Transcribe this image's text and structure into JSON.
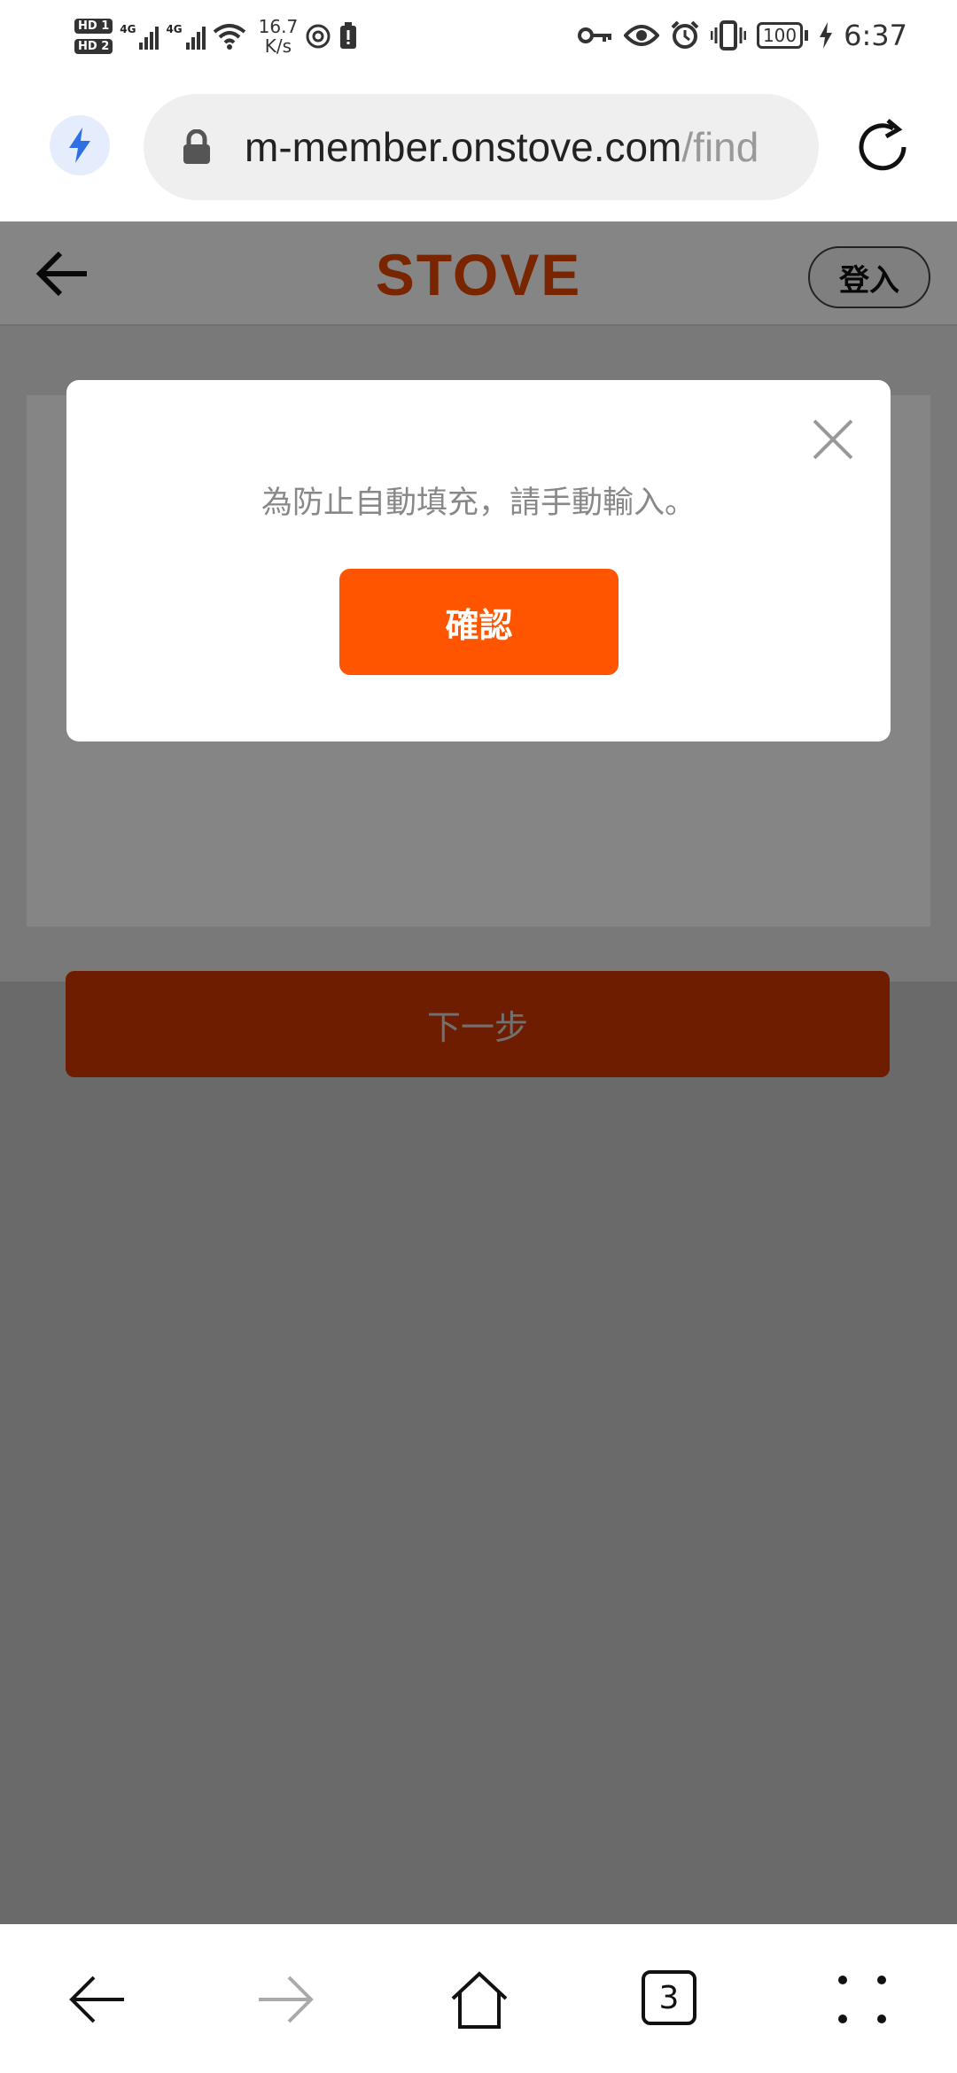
{
  "status_bar": {
    "hd1": "HD 1",
    "hd2": "HD 2",
    "sig1": "4G",
    "sig2": "4G",
    "speed_value": "16.7",
    "speed_unit": "K/s",
    "battery": "100",
    "time": "6:37"
  },
  "browser": {
    "url_main": "m-member.onstove.com",
    "url_rest": "/find",
    "tab_count": "3"
  },
  "header": {
    "logo": "STOVE",
    "login_label": "登入"
  },
  "page": {
    "next_label": "下一步"
  },
  "modal": {
    "message": "為防止自動填充，請手動輸入。",
    "confirm_label": "確認"
  },
  "colors": {
    "brand": "#ff5500",
    "logo": "#e84900"
  }
}
